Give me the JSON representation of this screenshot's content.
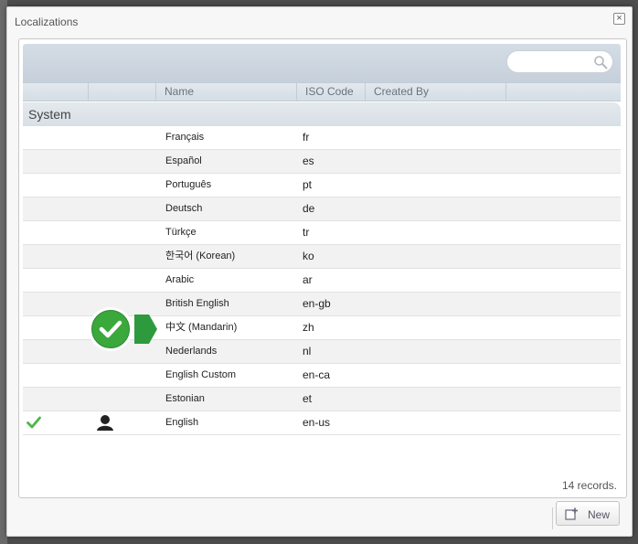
{
  "dialog": {
    "title": "Localizations",
    "close_glyph": "×"
  },
  "search": {
    "placeholder": "",
    "value": ""
  },
  "columns": [
    "",
    "",
    "Name",
    "ISO Code",
    "Created By",
    ""
  ],
  "group": {
    "label": "System"
  },
  "rows": [
    {
      "name": "Français",
      "iso": "fr",
      "active": false,
      "owner": false
    },
    {
      "name": "Español",
      "iso": "es",
      "active": false,
      "owner": false
    },
    {
      "name": "Português",
      "iso": "pt",
      "active": false,
      "owner": false
    },
    {
      "name": "Deutsch",
      "iso": "de",
      "active": false,
      "owner": false
    },
    {
      "name": "Türkçe",
      "iso": "tr",
      "active": false,
      "owner": false
    },
    {
      "name": "한국어 (Korean)",
      "iso": "ko",
      "active": false,
      "owner": false
    },
    {
      "name": "Arabic",
      "iso": "ar",
      "active": false,
      "owner": false
    },
    {
      "name": "British English",
      "iso": "en-gb",
      "active": false,
      "owner": false
    },
    {
      "name": "中文 (Mandarin)",
      "iso": "zh",
      "active": false,
      "owner": false
    },
    {
      "name": "Nederlands",
      "iso": "nl",
      "active": false,
      "owner": false
    },
    {
      "name": "English Custom",
      "iso": "en-ca",
      "active": false,
      "owner": false
    },
    {
      "name": "Estonian",
      "iso": "et",
      "active": false,
      "owner": false
    },
    {
      "name": "English",
      "iso": "en-us",
      "active": true,
      "owner": true
    }
  ],
  "footer": {
    "records_label": "14 records.",
    "new_button_label": "New"
  },
  "colors": {
    "accent_green": "#3aa83a",
    "check_green": "#4bb748",
    "header_bg": "#d5dde5"
  },
  "icons": {
    "search": "search-icon",
    "check": "check-icon",
    "user": "user-icon",
    "new": "add-document-icon",
    "close": "close-icon",
    "callout": "checkmark-callout-icon"
  }
}
